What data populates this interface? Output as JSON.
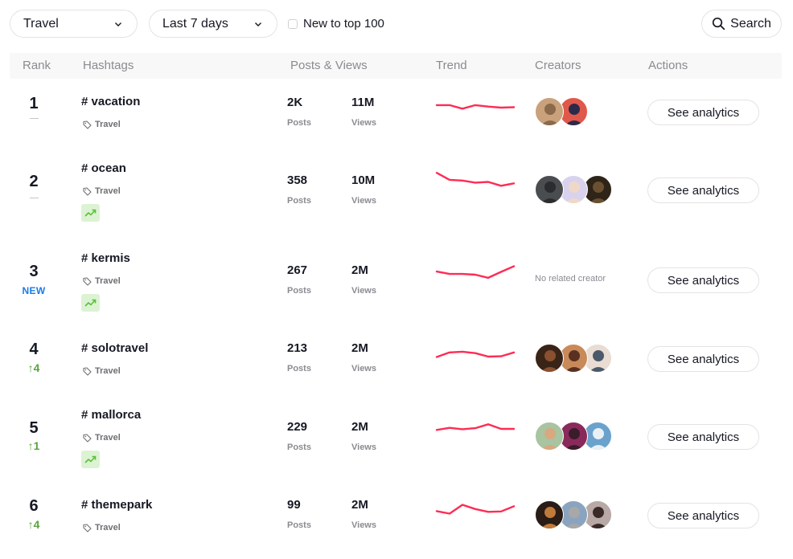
{
  "filters": {
    "industry": {
      "selected": "Travel",
      "icon": "chevron-down-icon"
    },
    "period": {
      "selected": "Last 7 days",
      "icon": "chevron-down-icon"
    },
    "new_to_top": {
      "label": "New to top 100",
      "checked": false
    },
    "search": {
      "label": "Search",
      "icon": "search-icon"
    }
  },
  "table": {
    "columns": [
      "Rank",
      "Hashtags",
      "Posts & Views",
      "Trend",
      "Creators",
      "Actions"
    ],
    "action_label": "See analytics",
    "posts_label": "Posts",
    "views_label": "Views",
    "no_creator_label": "No related creator",
    "rows": [
      {
        "rank": "1",
        "change": "—",
        "change_type": "same",
        "hashtag": "# vacation",
        "category": "Travel",
        "trending_badge": false,
        "posts": "2K",
        "views": "11M",
        "creators": [
          "creator-avatar-1",
          "creator-avatar-2"
        ],
        "trend": [
          5,
          5,
          4,
          5,
          4.6,
          4.3,
          4.4
        ]
      },
      {
        "rank": "2",
        "change": "—",
        "change_type": "same",
        "hashtag": "# ocean",
        "category": "Travel",
        "trending_badge": true,
        "posts": "358",
        "views": "10M",
        "creators": [
          "creator-avatar-1",
          "creator-avatar-2",
          "creator-avatar-3"
        ],
        "trend": [
          7,
          5,
          4.8,
          4.2,
          4.4,
          3.3,
          4
        ]
      },
      {
        "rank": "3",
        "change": "NEW",
        "change_type": "new",
        "hashtag": "# kermis",
        "category": "Travel",
        "trending_badge": true,
        "posts": "267",
        "views": "2M",
        "creators": [],
        "trend": [
          4.5,
          3.8,
          3.8,
          3.6,
          2.7,
          4.4,
          6
        ]
      },
      {
        "rank": "4",
        "change": "↑4",
        "change_type": "up",
        "hashtag": "# solotravel",
        "category": "Travel",
        "trending_badge": false,
        "posts": "213",
        "views": "2M",
        "creators": [
          "creator-avatar-1",
          "creator-avatar-2",
          "creator-avatar-3"
        ],
        "trend": [
          3.5,
          4.8,
          5,
          4.6,
          3.6,
          3.7,
          4.8
        ]
      },
      {
        "rank": "5",
        "change": "↑1",
        "change_type": "up",
        "hashtag": "# mallorca",
        "category": "Travel",
        "trending_badge": true,
        "posts": "229",
        "views": "2M",
        "creators": [
          "creator-avatar-1",
          "creator-avatar-2",
          "creator-avatar-3"
        ],
        "trend": [
          4,
          4.6,
          4.2,
          4.5,
          5.6,
          4.3,
          4.3
        ]
      },
      {
        "rank": "6",
        "change": "↑4",
        "change_type": "up",
        "hashtag": "# themepark",
        "category": "Travel",
        "trending_badge": false,
        "posts": "99",
        "views": "2M",
        "creators": [
          "creator-avatar-1",
          "creator-avatar-2",
          "creator-avatar-3"
        ],
        "trend": [
          4.2,
          3.5,
          6,
          4.8,
          4,
          4.1,
          5.6
        ]
      }
    ]
  },
  "colors": {
    "trend_line": "#fe2c55",
    "rank_new": "#1a7ae8",
    "rank_up": "#5aa43f",
    "badge_bg": "#dcf3d3",
    "badge_icon": "#5cbf3a"
  }
}
